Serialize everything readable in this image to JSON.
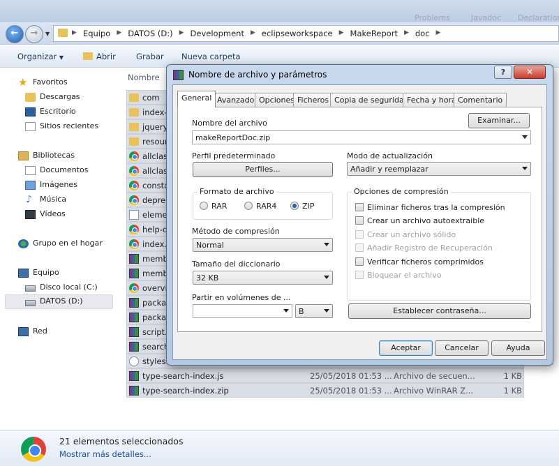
{
  "top_strip": {
    "faint_items": [
      "Problems",
      "Javadoc",
      "Declaration"
    ]
  },
  "address": {
    "crumbs": [
      "Equipo",
      "DATOS (D:)",
      "Development",
      "eclipseworkspace",
      "MakeReport",
      "doc"
    ]
  },
  "toolbar": {
    "organize": "Organizar",
    "open": "Abrir",
    "burn": "Grabar",
    "new_folder": "Nueva carpeta"
  },
  "sidebar": {
    "favorites": "Favoritos",
    "downloads": "Descargas",
    "desktop": "Escritorio",
    "recent": "Sitios recientes",
    "libraries": "Bibliotecas",
    "documents": "Documentos",
    "pictures": "Imágenes",
    "music": "Música",
    "videos": "Vídeos",
    "homegroup": "Grupo en el hogar",
    "computer": "Equipo",
    "local_disk": "Disco local (C:)",
    "data_drive": "DATOS (D:)",
    "network": "Red"
  },
  "filelist": {
    "col_name": "Nombre",
    "rows": [
      {
        "name": "com",
        "icon": "folder",
        "date": "",
        "type": "",
        "size": ""
      },
      {
        "name": "index-",
        "icon": "folder",
        "date": "",
        "type": "",
        "size": ""
      },
      {
        "name": "jquery",
        "icon": "folder",
        "date": "",
        "type": "",
        "size": ""
      },
      {
        "name": "resour",
        "icon": "folder",
        "date": "",
        "type": "",
        "size": ""
      },
      {
        "name": "allclas",
        "icon": "chrome",
        "date": "",
        "type": "",
        "size": ""
      },
      {
        "name": "allclas",
        "icon": "chrome",
        "date": "",
        "type": "",
        "size": ""
      },
      {
        "name": "consta",
        "icon": "chrome",
        "date": "",
        "type": "",
        "size": ""
      },
      {
        "name": "depre",
        "icon": "chrome",
        "date": "",
        "type": "",
        "size": ""
      },
      {
        "name": "eleme",
        "icon": "file",
        "date": "",
        "type": "",
        "size": ""
      },
      {
        "name": "help-d",
        "icon": "chrome",
        "date": "",
        "type": "",
        "size": ""
      },
      {
        "name": "index.h",
        "icon": "chrome",
        "date": "",
        "type": "",
        "size": ""
      },
      {
        "name": "memb",
        "icon": "rar",
        "date": "",
        "type": "",
        "size": ""
      },
      {
        "name": "memb",
        "icon": "rar",
        "date": "",
        "type": "",
        "size": ""
      },
      {
        "name": "overvi",
        "icon": "chrome",
        "date": "",
        "type": "",
        "size": ""
      },
      {
        "name": "packag",
        "icon": "rar",
        "date": "",
        "type": "",
        "size": ""
      },
      {
        "name": "packag",
        "icon": "rar",
        "date": "",
        "type": "",
        "size": ""
      },
      {
        "name": "script.j",
        "icon": "rar",
        "date": "",
        "type": "",
        "size": ""
      },
      {
        "name": "search",
        "icon": "rar",
        "date": "",
        "type": "",
        "size": ""
      },
      {
        "name": "stylesh",
        "icon": "gear",
        "date": "",
        "type": "",
        "size": ""
      },
      {
        "name": "type-search-index.js",
        "icon": "rar",
        "date": "25/05/2018 01:53 ...",
        "type": "Archivo de secuen...",
        "size": "1 KB"
      },
      {
        "name": "type-search-index.zip",
        "icon": "rar",
        "date": "25/05/2018 01:53 ...",
        "type": "Archivo WinRAR Z...",
        "size": "1 KB"
      }
    ]
  },
  "details": {
    "count": "21 elementos seleccionados",
    "more": "Mostrar más detalles..."
  },
  "dialog": {
    "title": "Nombre de archivo y parámetros",
    "help": "?",
    "close": "✕",
    "tabs": [
      "General",
      "Avanzado",
      "Opciones",
      "Ficheros",
      "Copia de seguridad",
      "Fecha y hora",
      "Comentario"
    ],
    "archive_name_label": "Nombre del archivo",
    "browse": "Examinar...",
    "archive_name_value": "makeReportDoc.zip",
    "profile_label": "Perfil predeterminado",
    "profiles": "Perfiles...",
    "update_mode_label": "Modo de actualización",
    "update_mode_value": "Añadir y reemplazar",
    "format_group": "Formato de archivo",
    "format_rar": "RAR",
    "format_rar4": "RAR4",
    "format_zip": "ZIP",
    "compression_method_label": "Método de compresión",
    "compression_method_value": "Normal",
    "dictionary_label": "Tamaño del diccionario",
    "dictionary_value": "32 KB",
    "split_label": "Partir en volúmenes de ...",
    "split_value": "",
    "split_unit": "B",
    "options_group": "Opciones de compresión",
    "opt_delete": "Eliminar ficheros tras la compresión",
    "opt_sfx": "Crear un archivo autoextraible",
    "opt_solid": "Crear un archivo sólido",
    "opt_recovery": "Añadir Registro de Recuperación",
    "opt_test": "Verificar ficheros comprimidos",
    "opt_lock": "Bloquear el archivo",
    "set_password": "Establecer contraseña...",
    "ok": "Aceptar",
    "cancel": "Cancelar",
    "help_button": "Ayuda"
  }
}
